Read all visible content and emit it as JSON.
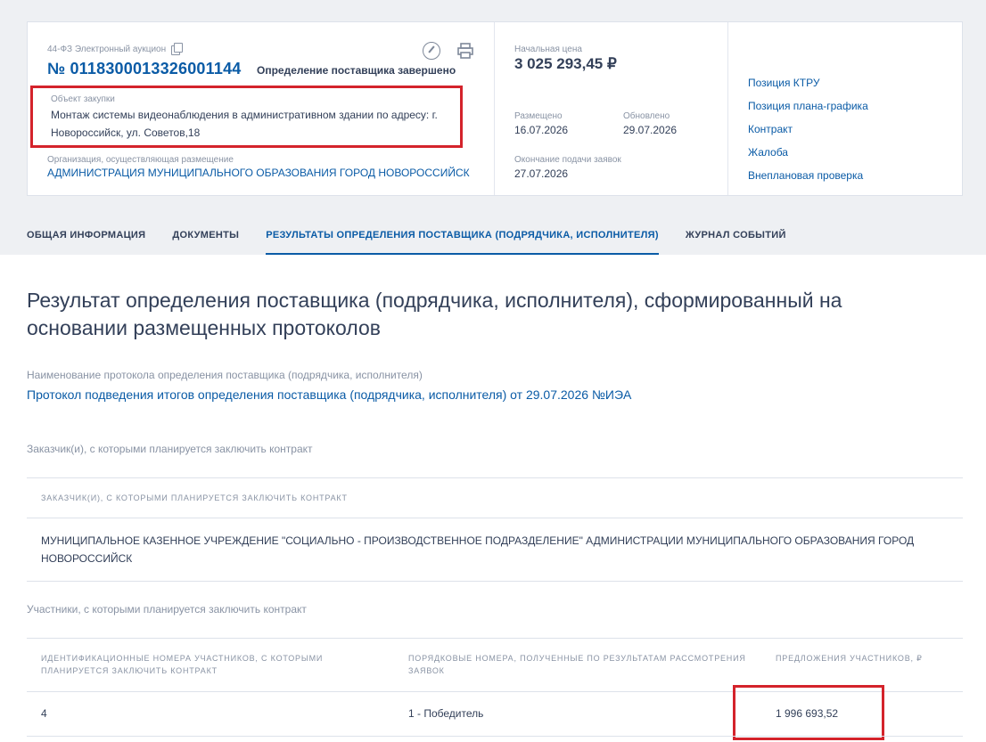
{
  "header": {
    "law_type": "44-ФЗ Электронный аукцион",
    "number": "№ 0118300013326001144",
    "status": "Определение поставщика завершено",
    "object_label": "Объект закупки",
    "object_text": "Монтаж системы видеонаблюдения в административном здании по адресу: г. Новороссийск, ул. Советов,18",
    "org_label": "Организация, осуществляющая размещение",
    "org_name": "АДМИНИСТРАЦИЯ МУНИЦИПАЛЬНОГО ОБРАЗОВАНИЯ ГОРОД НОВОРОССИЙСК",
    "price_label": "Начальная цена",
    "price": "3 025 293,45 ₽",
    "posted_label": "Размещено",
    "posted_date": "16.07.2026",
    "updated_label": "Обновлено",
    "updated_date": "29.07.2026",
    "deadline_label": "Окончание подачи заявок",
    "deadline_date": "27.07.2026",
    "links": [
      "Позиция КТРУ",
      "Позиция плана-графика",
      "Контракт",
      "Жалоба",
      "Внеплановая проверка"
    ]
  },
  "tabs": [
    "ОБЩАЯ ИНФОРМАЦИЯ",
    "ДОКУМЕНТЫ",
    "РЕЗУЛЬТАТЫ ОПРЕДЕЛЕНИЯ ПОСТАВЩИКА (ПОДРЯДЧИКА, ИСПОЛНИТЕЛЯ)",
    "ЖУРНАЛ СОБЫТИЙ"
  ],
  "main": {
    "heading": "Результат определения поставщика (подрядчика, исполнителя), сформированный на основании размещенных протоколов",
    "protocol_label": "Наименование протокола определения поставщика (подрядчика, исполнителя)",
    "protocol_link": "Протокол подведения итогов определения поставщика (подрядчика, исполнителя) от 29.07.2026 №ИЭА",
    "customers_label": "Заказчик(и), с которыми планируется заключить контракт",
    "customers_table_header": "ЗАКАЗЧИК(И), С КОТОРЫМИ ПЛАНИРУЕТСЯ ЗАКЛЮЧИТЬ КОНТРАКТ",
    "customer_name": "МУНИЦИПАЛЬНОЕ КАЗЕННОЕ УЧРЕЖДЕНИЕ \"СОЦИАЛЬНО - ПРОИЗВОДСТВЕННОЕ ПОДРАЗДЕЛЕНИЕ\" АДМИНИСТРАЦИИ МУНИЦИПАЛЬНОГО ОБРАЗОВАНИЯ ГОРОД НОВОРОССИЙСК",
    "participants_label": "Участники, с которыми планируется заключить контракт",
    "participants_headers": [
      "ИДЕНТИФИКАЦИОННЫЕ НОМЕРА УЧАСТНИКОВ, С КОТОРЫМИ ПЛАНИРУЕТСЯ ЗАКЛЮЧИТЬ КОНТРАКТ",
      "ПОРЯДКОВЫЕ НОМЕРА, ПОЛУЧЕННЫЕ ПО РЕЗУЛЬТАТАМ РАССМОТРЕНИЯ ЗАЯВОК",
      "ПРЕДЛОЖЕНИЯ УЧАСТНИКОВ, ₽"
    ],
    "participants_rows": [
      [
        "4",
        "1 - Победитель",
        "1 996 693,52"
      ]
    ]
  },
  "colors": {
    "accent": "#0a5ba6",
    "highlight": "#d4232b",
    "text": "#334059",
    "muted": "#8993a4"
  }
}
